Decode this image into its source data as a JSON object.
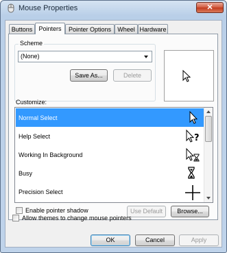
{
  "window": {
    "title": "Mouse Properties",
    "close_glyph": "✕"
  },
  "tabs": [
    {
      "label": "Buttons"
    },
    {
      "label": "Pointers"
    },
    {
      "label": "Pointer Options"
    },
    {
      "label": "Wheel"
    },
    {
      "label": "Hardware"
    }
  ],
  "active_tab": "Pointers",
  "scheme": {
    "group_label": "Scheme",
    "selected": "(None)",
    "save_as_label": "Save As...",
    "delete_label": "Delete"
  },
  "customize": {
    "label": "Customize:",
    "items": [
      {
        "label": "Normal Select",
        "cursor": "arrow-icon",
        "selected": true
      },
      {
        "label": "Help Select",
        "cursor": "help-cursor-icon",
        "selected": false
      },
      {
        "label": "Working In Background",
        "cursor": "working-cursor-icon",
        "selected": false
      },
      {
        "label": "Busy",
        "cursor": "hourglass-icon",
        "selected": false
      },
      {
        "label": "Precision Select",
        "cursor": "crosshair-icon",
        "selected": false
      }
    ]
  },
  "options": {
    "pointer_shadow_label": "Enable pointer shadow",
    "pointer_shadow_checked": false,
    "use_default_label": "Use Default",
    "browse_label": "Browse...",
    "allow_themes_label": "Allow themes to change mouse pointers",
    "allow_themes_checked": false
  },
  "footer": {
    "ok_label": "OK",
    "cancel_label": "Cancel",
    "apply_label": "Apply"
  },
  "colors": {
    "selection": "#3399ff",
    "title_bar": "#c2d6ec"
  }
}
